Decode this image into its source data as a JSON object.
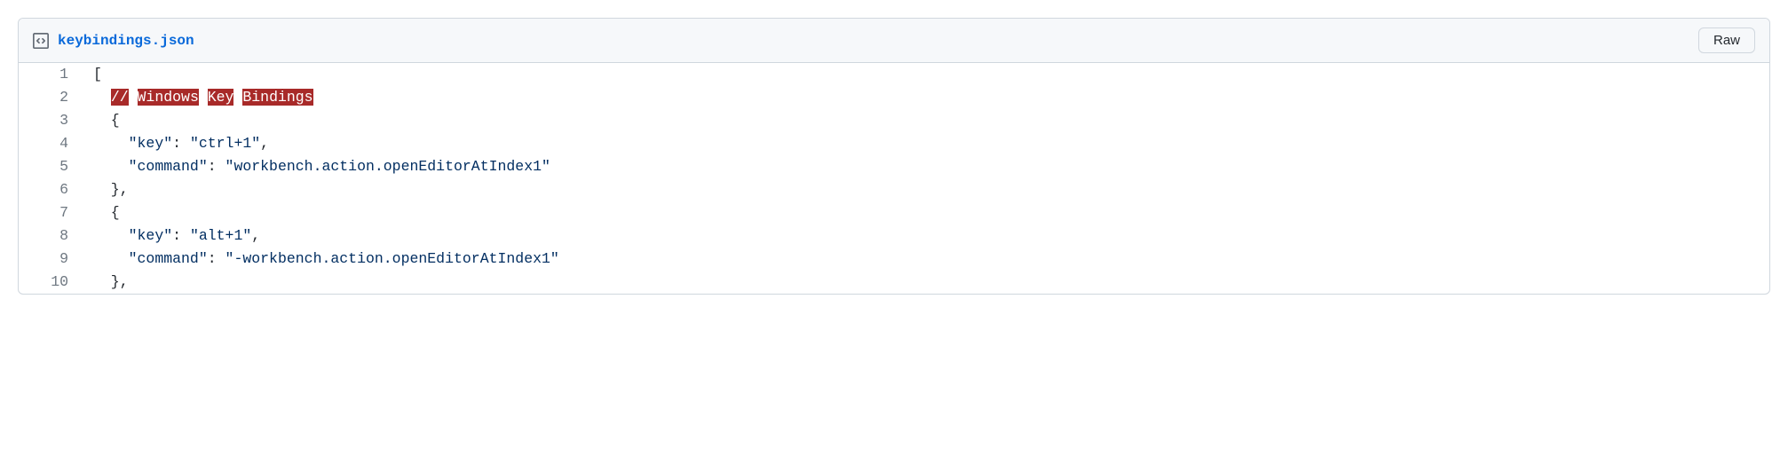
{
  "filename": "keybindings.json",
  "raw_button_label": "Raw",
  "line_numbers": [
    "1",
    "2",
    "3",
    "4",
    "5",
    "6",
    "7",
    "8",
    "9",
    "10"
  ],
  "code": {
    "l1": "[",
    "l2_indent": "  ",
    "l2_t1": "//",
    "l2_t2": "Windows",
    "l2_t3": "Key",
    "l2_t4": "Bindings",
    "l3": "  {",
    "l4_indent": "    ",
    "l4_key": "\"key\"",
    "l4_colon": ": ",
    "l4_val": "\"ctrl+1\"",
    "l4_tail": ",",
    "l5_indent": "    ",
    "l5_key": "\"command\"",
    "l5_colon": ": ",
    "l5_val": "\"workbench.action.openEditorAtIndex1\"",
    "l6": "  },",
    "l7": "  {",
    "l8_indent": "    ",
    "l8_key": "\"key\"",
    "l8_colon": ": ",
    "l8_val": "\"alt+1\"",
    "l8_tail": ",",
    "l9_indent": "    ",
    "l9_key": "\"command\"",
    "l9_colon": ": ",
    "l9_val": "\"-workbench.action.openEditorAtIndex1\"",
    "l10": "  },"
  }
}
